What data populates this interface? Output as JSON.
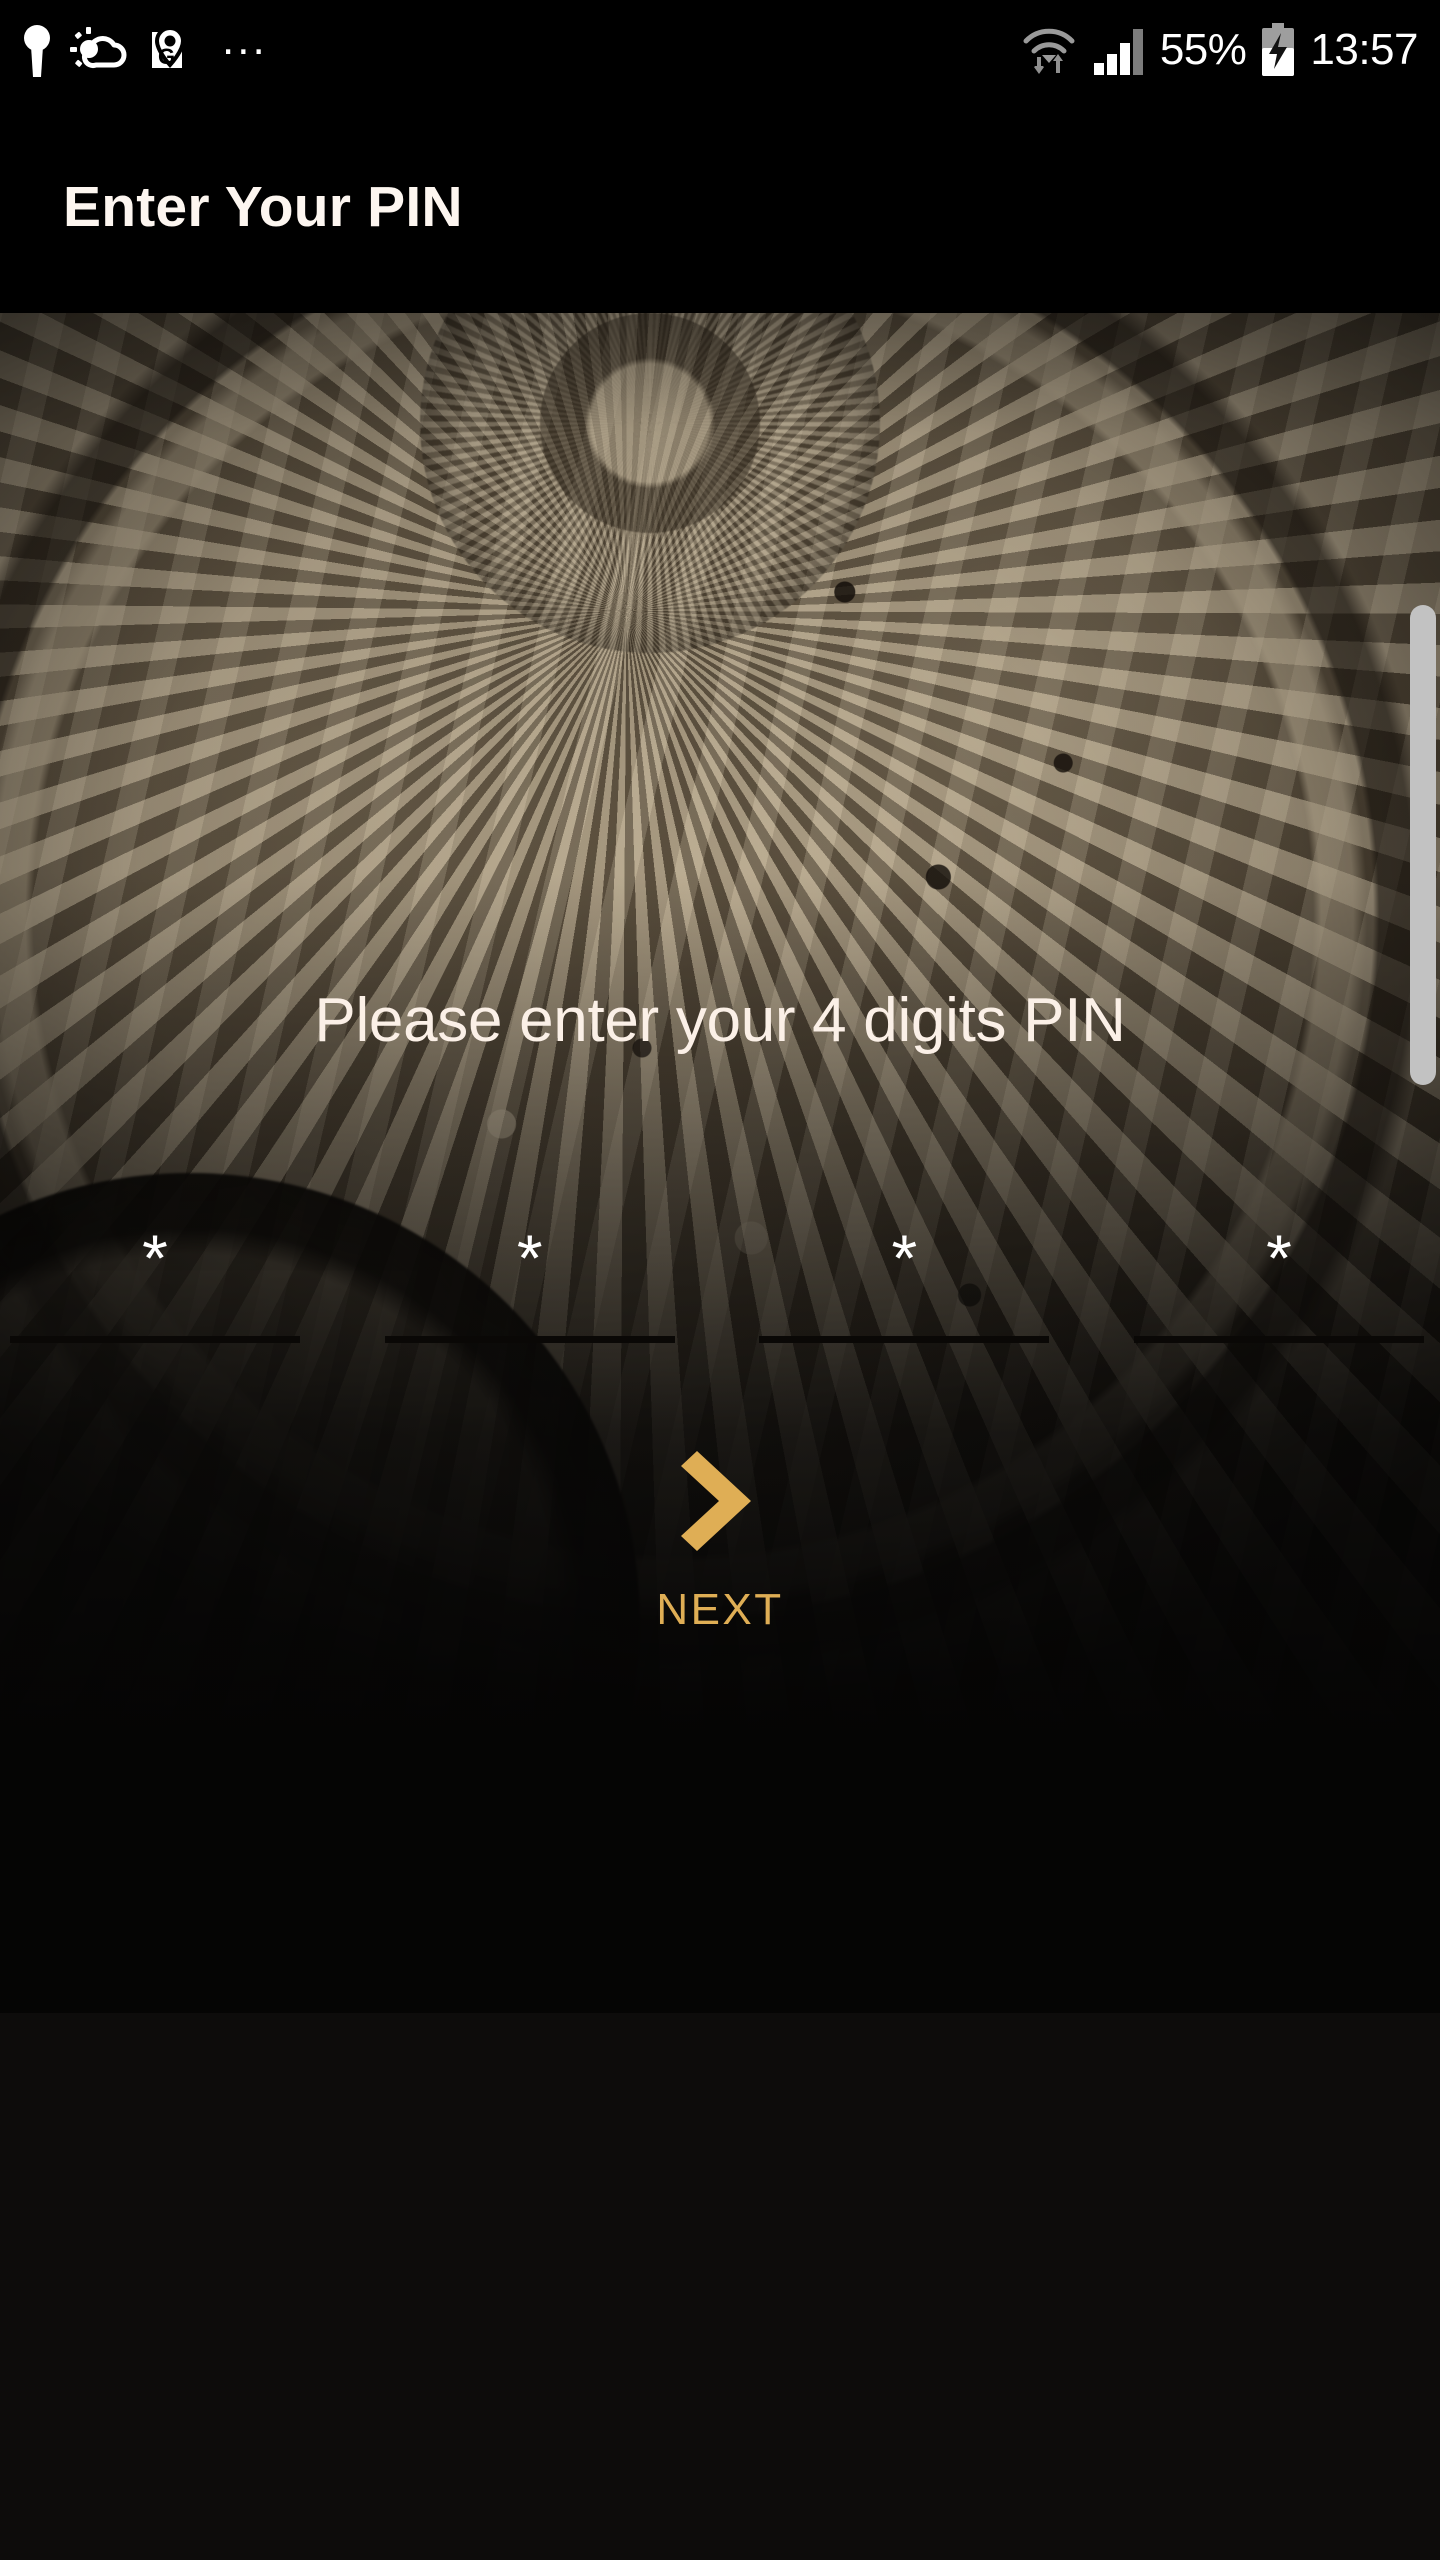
{
  "status_bar": {
    "left_icons": [
      {
        "name": "keyhole-icon",
        "label": "Keyhole notification"
      },
      {
        "name": "weather-sun-cloud-icon",
        "label": "Weather"
      },
      {
        "name": "maps-pin-icon",
        "label": "Maps navigation"
      }
    ],
    "overflow_indicator": "...",
    "wifi_icon": "wifi-data-transfer-icon",
    "signal_icon": "cellular-signal-icon",
    "signal_bars_filled": 3,
    "signal_bars_total": 4,
    "battery_percent": "55%",
    "battery_icon": "battery-charging-icon",
    "time": "13:57"
  },
  "title_bar": {
    "title": "Enter Your PIN"
  },
  "main": {
    "prompt": "Please enter your 4 digits PIN",
    "pin_fields": [
      {
        "name": "pin-digit-1",
        "value": "*"
      },
      {
        "name": "pin-digit-2",
        "value": "*"
      },
      {
        "name": "pin-digit-3",
        "value": "*"
      },
      {
        "name": "pin-digit-4",
        "value": "*"
      }
    ],
    "pin_length": 4,
    "next_button": {
      "label": "NEXT",
      "icon": "chevron-right-icon"
    }
  },
  "colors": {
    "accent_gold": "#dfae55",
    "status_bar_bg": "#000000",
    "title_bar_bg": "#000000",
    "page_bg": "#0d0c0b",
    "text_light": "#fbf0e7",
    "pin_underline": "#0a0806",
    "scrollbar_thumb": "#c2c2c2"
  },
  "scrollbar": {
    "name": "vertical-scrollbar",
    "visible": true
  }
}
